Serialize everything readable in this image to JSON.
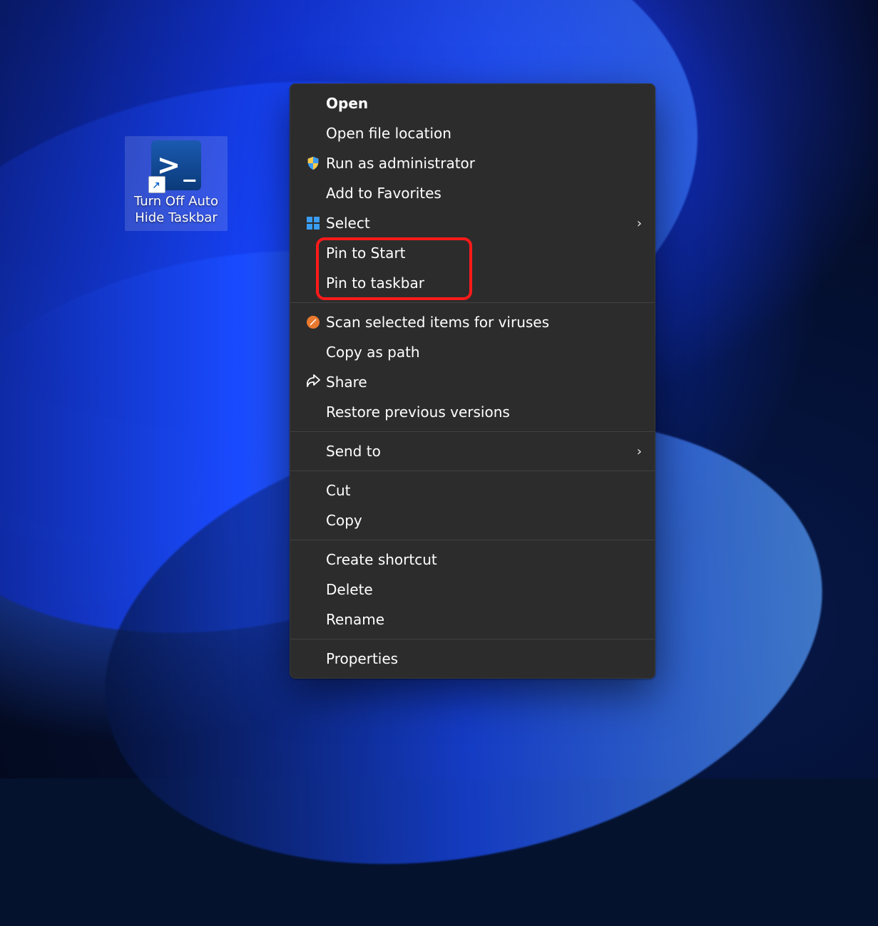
{
  "desktop": {
    "shortcut_label": "Turn Off Auto Hide Taskbar"
  },
  "context_menu": {
    "open": "Open",
    "open_file_location": "Open file location",
    "run_as_admin": "Run as administrator",
    "add_to_favorites": "Add to Favorites",
    "select": "Select",
    "pin_to_start": "Pin to Start",
    "pin_to_taskbar": "Pin to taskbar",
    "scan_virus": "Scan selected items for viruses",
    "copy_as_path": "Copy as path",
    "share": "Share",
    "restore_versions": "Restore previous versions",
    "send_to": "Send to",
    "cut": "Cut",
    "copy": "Copy",
    "create_shortcut": "Create shortcut",
    "delete": "Delete",
    "rename": "Rename",
    "properties": "Properties"
  }
}
